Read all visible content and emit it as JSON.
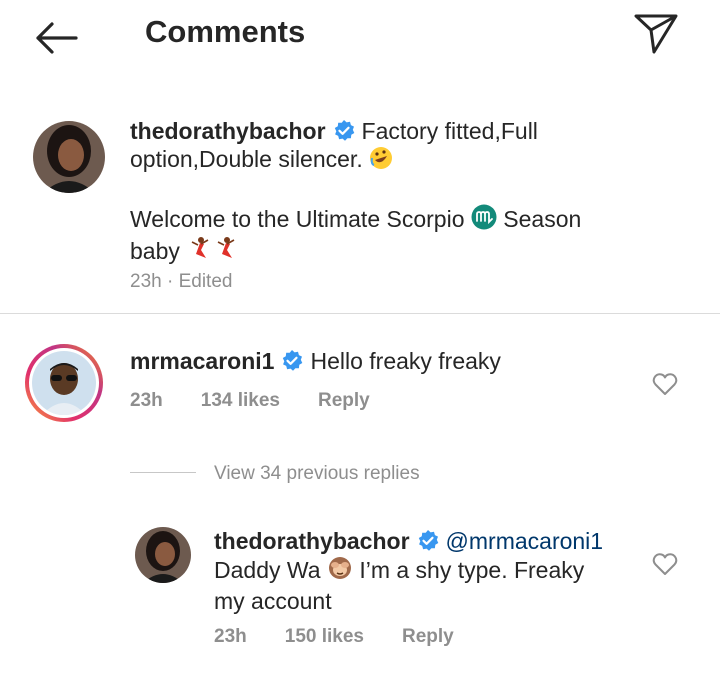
{
  "header": {
    "title": "Comments"
  },
  "caption": {
    "username": "thedorathybachor",
    "line1_after_name": "Factory fitted,Full",
    "line2": "option,Double silencer.",
    "line3": "Welcome to the Ultimate Scorpio",
    "line3_after_emoji": "Season",
    "line4": "baby",
    "time": "23h",
    "edited": "Edited"
  },
  "comment": {
    "username": "mrmacaroni1",
    "text": "Hello freaky freaky",
    "time": "23h",
    "likes": "134 likes",
    "reply_label": "Reply"
  },
  "replies_toggle": {
    "label": "View 34 previous replies"
  },
  "reply": {
    "username": "thedorathybachor",
    "mention": "@mrmacaroni1",
    "text_before_emoji": "Daddy Wa",
    "text_after_emoji": "I’m a shy type. Freaky",
    "line3": "my account",
    "time": "23h",
    "likes": "150 likes",
    "reply_label": "Reply"
  },
  "colors": {
    "verified": "#3897f0",
    "muted": "#8e8e8e",
    "text": "#262626"
  },
  "icons": [
    "back-arrow-icon",
    "send-icon",
    "verified-icon",
    "heart-icon",
    "rofl-emoji",
    "scorpio-emoji",
    "dancer-emoji",
    "see-no-evil-monkey-emoji"
  ]
}
